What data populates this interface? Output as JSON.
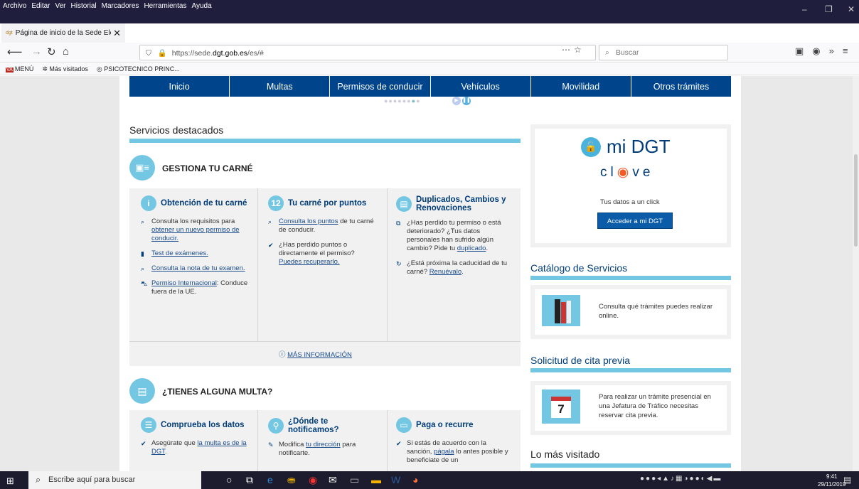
{
  "browser": {
    "menu": [
      "Archivo",
      "Editar",
      "Ver",
      "Historial",
      "Marcadores",
      "Herramientas",
      "Ayuda"
    ],
    "tab_title": "Página de inicio de la Sede Ele",
    "tab_favicon": "dgt-favicon",
    "url_prefix": "https://sede.",
    "url_domain": "dgt.gob.es",
    "url_suffix": "/es/#",
    "search_placeholder": "Buscar",
    "bookmarks": [
      "MENÚ",
      "Más visitados",
      "PSICOTECNICO PRINC..."
    ],
    "bookmark_va": "VA"
  },
  "nav": [
    "Inicio",
    "Multas",
    "Permisos de conducir",
    "Vehículos",
    "Movilidad",
    "Otros trámites"
  ],
  "servicios": {
    "title": "Servicios destacados"
  },
  "carne": {
    "title": "GESTIONA TU CARNÉ",
    "col1": {
      "icon": "i",
      "title": "Obtención de tu carné",
      "i1_pre": "Consulta los requisitos para ",
      "i1_link": "obtener un nuevo permiso de conducir.",
      "i2_link": "Test de exámenes.",
      "i3_link": "Consulta la nota de tu examen.",
      "i4_link": "Permiso Internacional",
      "i4_post": ": Conduce fuera de la UE."
    },
    "col2": {
      "icon": "12",
      "title": "Tu carné por puntos",
      "i1_link": "Consulta los puntos",
      "i1_post": " de tu carné de conducir.",
      "i2_pre": "¿Has perdido puntos o directamente el permiso? ",
      "i2_link": "Puedes recuperarlo."
    },
    "col3": {
      "title": "Duplicados, Cambios y Renovaciones",
      "i1_pre": "¿Has perdido tu permiso o está deteriorado? ¿Tus datos personales han sufrido algún cambio? Pide tu ",
      "i1_link": "duplicado",
      "i2_pre": "¿Está próxima la caducidad de tu carné? ",
      "i2_link": "Renuévalo"
    },
    "more": "MÁS INFORMACIÓN"
  },
  "multa": {
    "title": "¿TIENES ALGUNA MULTA?",
    "col1": {
      "title": "Comprueba los datos",
      "i1_pre": "Asegúrate que ",
      "i1_link": "la multa es de la DGT",
      "i1_post": "."
    },
    "col2": {
      "title": "¿Dónde te notificamos?",
      "i1_pre": "Modifica ",
      "i1_link": "tu dirección",
      "i1_post": " para notificarte."
    },
    "col3": {
      "title": "Paga o recurre",
      "i1_pre": "Si estás de acuerdo con la sanción, ",
      "i1_link": "págala",
      "i1_post": " lo antes posible y beneficiate de un"
    }
  },
  "midgt": {
    "logo": "mi DGT",
    "clave_a": "cl",
    "clave_b": "ve",
    "tagline": "Tus datos a un click",
    "button": "Acceder a mi DGT"
  },
  "catalogo": {
    "title": "Catálogo de Servicios",
    "text": "Consulta qué trámites puedes realizar online."
  },
  "cita": {
    "title": "Solicitud de cita previa",
    "text": "Para realizar un trámite presencial en una Jefatura de Tráfico necesitas reservar cita previa.",
    "day": "7"
  },
  "visitado": {
    "title": "Lo más visitado"
  },
  "taskbar": {
    "search": "Escribe aquí para buscar",
    "time": "9:41",
    "date": "29/11/2019"
  }
}
